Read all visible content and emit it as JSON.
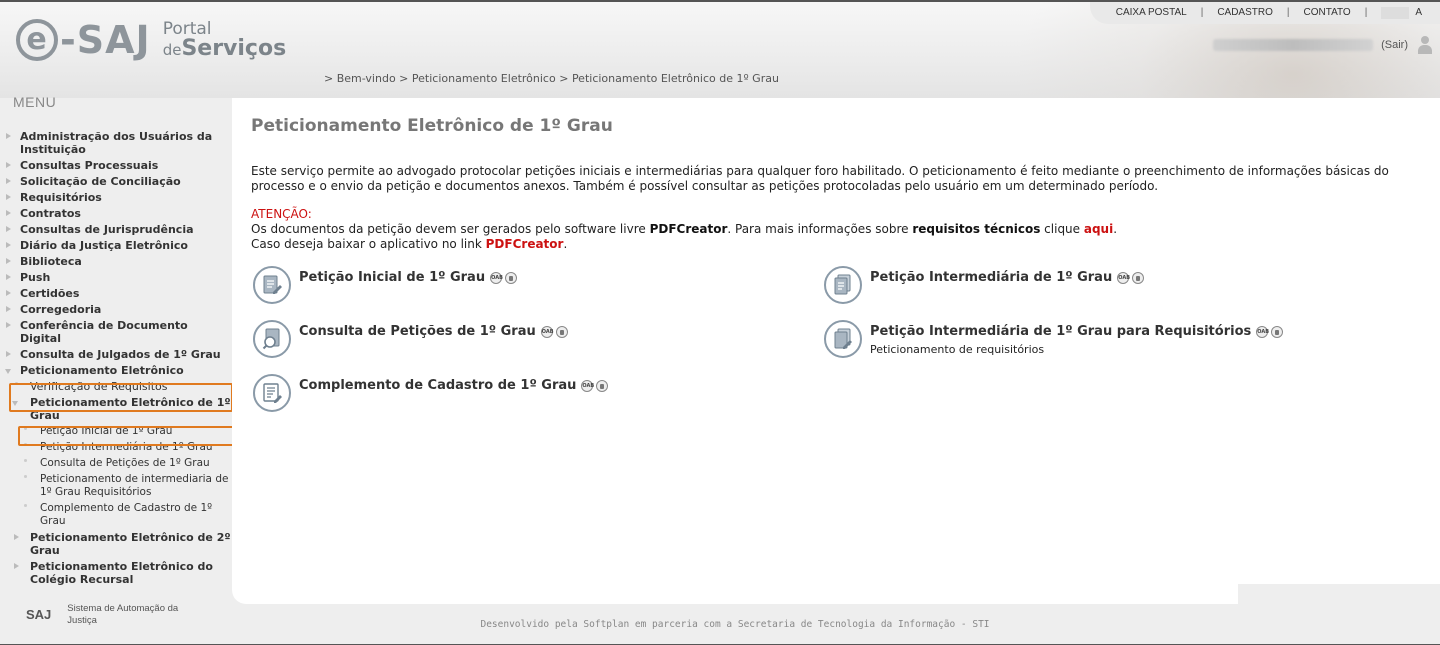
{
  "header": {
    "logo_main": "e-SAJ",
    "logo_portal": "Portal",
    "logo_de": "de",
    "logo_servicos": "Serviços",
    "topnav": [
      "CAIXA POSTAL",
      "CADASTRO",
      "CONTATO",
      "A"
    ],
    "sair": "(Sair)"
  },
  "breadcrumb": {
    "items": [
      "Bem-vindo",
      "Peticionamento Eletrônico",
      "Peticionamento Eletrônico de 1º Grau"
    ]
  },
  "sidebar": {
    "title": "MENU",
    "items": [
      "Administração dos Usuários da Instituição",
      "Consultas Processuais",
      "Solicitação de Conciliação",
      "Requisitórios",
      "Contratos",
      "Consultas de Jurisprudência",
      "Diário da Justiça Eletrônico",
      "Biblioteca",
      "Push",
      "Certidões",
      "Corregedoria",
      "Conferência de Documento Digital",
      "Consulta de Julgados de 1º Grau",
      "Peticionamento Eletrônico"
    ],
    "sub_verificacao": "Verificação de Requisitos",
    "sub_pet1": "Peticionamento Eletrônico de 1º Grau",
    "sub_pet1_items": [
      "Petição Inicial de 1º Grau",
      "Petição Intermediária de 1º Grau",
      "Consulta de Petições de 1º Grau",
      "Peticionamento de intermediaria de 1º Grau Requisitórios",
      "Complemento de Cadastro de 1º Grau"
    ],
    "sub_pet2": "Peticionamento Eletrônico de 2º Grau",
    "sub_colegio": "Peticionamento Eletrônico do Colégio Recursal"
  },
  "main": {
    "title": "Peticionamento Eletrônico de 1º Grau",
    "description": "Este serviço permite ao advogado protocolar petições iniciais e intermediárias para qualquer foro habilitado. O peticionamento é feito mediante o preenchimento de informações básicas do processo e o envio da petição e documentos anexos. Também é possível consultar as petições protocoladas pelo usuário em um determinado período.",
    "attention_label": "ATENÇÃO:",
    "attention_line1_a": "Os documentos da petição devem ser gerados pelo software livre ",
    "attention_pdfcreator": "PDFCreator",
    "attention_line1_b": ". Para mais informações sobre ",
    "attention_req": "requisitos técnicos",
    "attention_line1_c": " clique ",
    "attention_aqui": "aqui",
    "attention_line1_d": ".",
    "attention_line2_a": "Caso deseja baixar o aplicativo no link ",
    "attention_line2_link": "PDFCreator",
    "attention_line2_b": ".",
    "services": {
      "inicial": {
        "name": "Petição Inicial de 1º Grau"
      },
      "intermediaria": {
        "name": "Petição Intermediária de 1º Grau"
      },
      "consulta": {
        "name": "Consulta de Petições de 1º Grau"
      },
      "requisitorios": {
        "name": "Petição Intermediária de 1º Grau para Requisitórios",
        "sub": "Peticionamento de requisitórios"
      },
      "complemento": {
        "name": "Complemento de Cadastro de 1º Grau"
      }
    },
    "badge_text": "OAB"
  },
  "footer": {
    "saj": "SAJ",
    "saj_desc": "Sistema de Automação da Justiça",
    "credits": "Desenvolvido pela Softplan em parceria com a Secretaria de Tecnologia da Informação - STI"
  }
}
